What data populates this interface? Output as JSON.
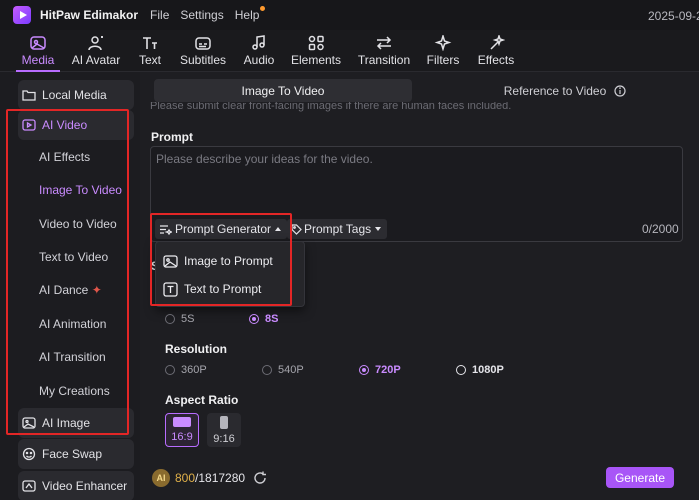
{
  "titlebar": {
    "app_name": "HitPaw Edimakor",
    "menu": [
      "File",
      "Settings",
      "Help"
    ],
    "date": "2025-09-2"
  },
  "toolbar": {
    "tools": [
      {
        "label": "Media",
        "icon": "media-icon"
      },
      {
        "label": "AI Avatar",
        "icon": "ai-avatar-icon"
      },
      {
        "label": "Text",
        "icon": "text-icon"
      },
      {
        "label": "Subtitles",
        "icon": "subtitles-icon"
      },
      {
        "label": "Audio",
        "icon": "audio-icon"
      },
      {
        "label": "Elements",
        "icon": "elements-icon"
      },
      {
        "label": "Transition",
        "icon": "transition-icon"
      },
      {
        "label": "Filters",
        "icon": "filters-icon"
      },
      {
        "label": "Effects",
        "icon": "effects-icon"
      }
    ],
    "active": "Media"
  },
  "sidebar": {
    "local_media": "Local Media",
    "ai_video": "AI Video",
    "sub_items": [
      "AI Effects",
      "Image To Video",
      "Video to Video",
      "Text to Video",
      "AI Dance",
      "AI Animation",
      "AI Transition",
      "My Creations"
    ],
    "active_sub": "Image To Video",
    "ai_image": "AI Image",
    "face_swap": "Face Swap",
    "video_enhancer": "Video Enhancer"
  },
  "main": {
    "tabs": [
      "Image To Video",
      "Reference to Video"
    ],
    "active_tab": "Image To Video",
    "notice": "Please submit clear front-facing images if there are human faces included.",
    "prompt_label": "Prompt",
    "prompt_placeholder": "Please describe your ideas for the video.",
    "prompt_generator": "Prompt Generator",
    "prompt_tags": "Prompt Tags",
    "counter": "0/2000",
    "dropdown": [
      "Image to Prompt",
      "Text to Prompt"
    ],
    "hidden_label_initial": "S",
    "duration_options": [
      "5S",
      "8S"
    ],
    "duration_selected": "8S",
    "resolution_label": "Resolution",
    "resolution_options": [
      "360P",
      "540P",
      "720P",
      "1080P"
    ],
    "resolution_selected": "720P",
    "aspect_label": "Aspect Ratio",
    "aspect_options": [
      "16:9",
      "9:16"
    ],
    "aspect_selected": "16:9",
    "credits_used": "800",
    "credits_total": "/1817280",
    "generate": "Generate"
  },
  "colors": {
    "accent": "#a855f7",
    "accent_text": "#c98bff",
    "highlight_box": "#e32626",
    "background": "#1c1c20"
  }
}
